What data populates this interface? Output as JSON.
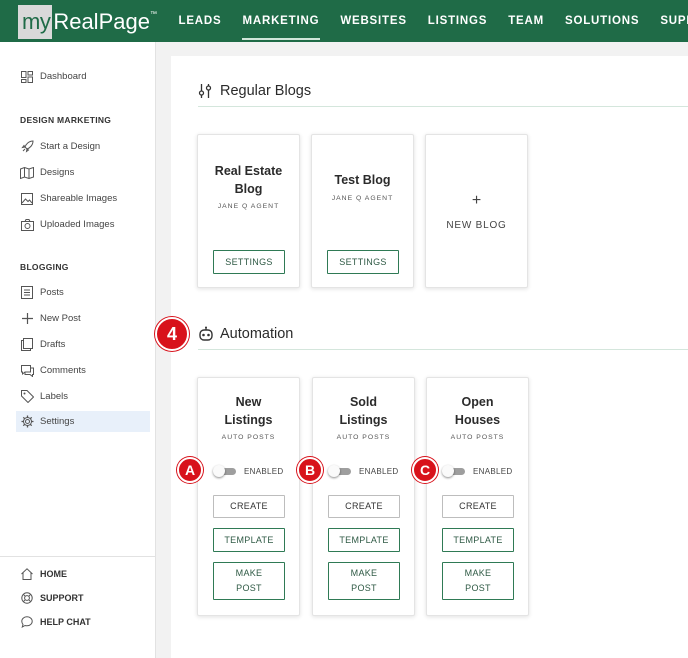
{
  "brand": {
    "my": "my",
    "name": "RealPage",
    "tm": "™"
  },
  "nav": {
    "items": [
      {
        "label": "LEADS"
      },
      {
        "label": "MARKETING"
      },
      {
        "label": "WEBSITES"
      },
      {
        "label": "LISTINGS"
      },
      {
        "label": "TEAM"
      },
      {
        "label": "SOLUTIONS"
      },
      {
        "label": "SUPPORT"
      }
    ],
    "active": "MARKETING"
  },
  "sidebar": {
    "dashboard": "Dashboard",
    "design_heading": "DESIGN MARKETING",
    "design_items": [
      {
        "label": "Start a Design",
        "icon": "rocket-icon"
      },
      {
        "label": "Designs",
        "icon": "map-icon"
      },
      {
        "label": "Shareable Images",
        "icon": "image-icon"
      },
      {
        "label": "Uploaded Images",
        "icon": "camera-icon"
      }
    ],
    "blogging_heading": "BLOGGING",
    "blogging_items": [
      {
        "label": "Posts",
        "icon": "list-icon"
      },
      {
        "label": "New Post",
        "icon": "plus-icon"
      },
      {
        "label": "Drafts",
        "icon": "pages-icon"
      },
      {
        "label": "Comments",
        "icon": "comment-icon"
      },
      {
        "label": "Labels",
        "icon": "tag-icon"
      },
      {
        "label": "Settings",
        "icon": "gear-icon"
      }
    ],
    "active": "Settings",
    "footer": [
      {
        "label": "HOME",
        "icon": "home-icon"
      },
      {
        "label": "SUPPORT",
        "icon": "lifebuoy-icon"
      },
      {
        "label": "HELP CHAT",
        "icon": "chat-icon"
      }
    ]
  },
  "blogs": {
    "title": "Regular Blogs",
    "cards": [
      {
        "title_line1": "Real Estate",
        "title_line2": "Blog",
        "agent": "JANE Q AGENT",
        "button": "SETTINGS"
      },
      {
        "title_line1": "Test Blog",
        "agent": "JANE Q AGENT",
        "button": "SETTINGS"
      }
    ],
    "new_plus": "+",
    "new_label": "NEW BLOG"
  },
  "automation": {
    "title": "Automation",
    "cards": [
      {
        "title_line1": "New",
        "title_line2": "Listings",
        "sub": "AUTO POSTS",
        "toggle": "ENABLED",
        "create": "CREATE",
        "template": "TEMPLATE",
        "make1": "MAKE",
        "make2": "POST",
        "marker": "A"
      },
      {
        "title_line1": "Sold",
        "title_line2": "Listings",
        "sub": "AUTO POSTS",
        "toggle": "ENABLED",
        "create": "CREATE",
        "template": "TEMPLATE",
        "make1": "MAKE",
        "make2": "POST",
        "marker": "B"
      },
      {
        "title_line1": "Open",
        "title_line2": "Houses",
        "sub": "AUTO POSTS",
        "toggle": "ENABLED",
        "create": "CREATE",
        "template": "TEMPLATE",
        "make1": "MAKE",
        "make2": "POST",
        "marker": "C"
      }
    ]
  },
  "step_marker": "4",
  "colors": {
    "brand_green": "#1f6b47",
    "marker_red": "#d8121b",
    "active_bg": "#e8f0fa"
  }
}
